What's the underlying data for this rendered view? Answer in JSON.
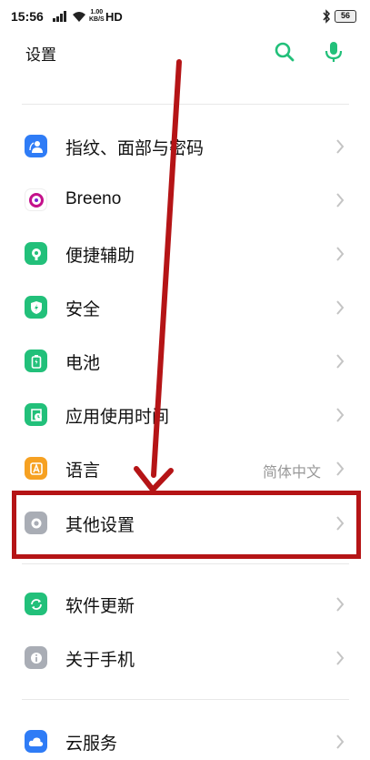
{
  "status_bar": {
    "time": "15:56",
    "net_speed_top": "1.00",
    "net_speed_bottom": "KB/S",
    "network_type": "HD",
    "battery": "56"
  },
  "header": {
    "title": "设置",
    "search_icon": "search-icon",
    "mic_icon": "mic-icon",
    "accent_color": "#22c07a"
  },
  "settings": {
    "items": [
      {
        "label": "指纹、面部与密码",
        "icon": "fingerprint-user-icon",
        "color": "#2f7cf6"
      },
      {
        "label": "Breeno",
        "icon": "breeno-icon",
        "color": "#c4118b"
      },
      {
        "label": "便捷辅助",
        "icon": "touch-assist-icon",
        "color": "#22c07a"
      },
      {
        "label": "安全",
        "icon": "shield-icon",
        "color": "#22c07a"
      },
      {
        "label": "电池",
        "icon": "battery-icon",
        "color": "#22c07a"
      },
      {
        "label": "应用使用时间",
        "icon": "app-timer-icon",
        "color": "#22c07a"
      },
      {
        "label": "语言",
        "value": "简体中文",
        "icon": "language-icon",
        "color": "#f6a122"
      },
      {
        "label": "其他设置",
        "icon": "other-settings-icon",
        "color": "#a9adb5"
      },
      {
        "label": "软件更新",
        "icon": "update-icon",
        "color": "#22c07a"
      },
      {
        "label": "关于手机",
        "icon": "info-icon",
        "color": "#a9adb5"
      },
      {
        "label": "云服务",
        "icon": "cloud-icon",
        "color": "#2f7cf6"
      }
    ]
  },
  "annotation": {
    "color": "#b51416"
  }
}
